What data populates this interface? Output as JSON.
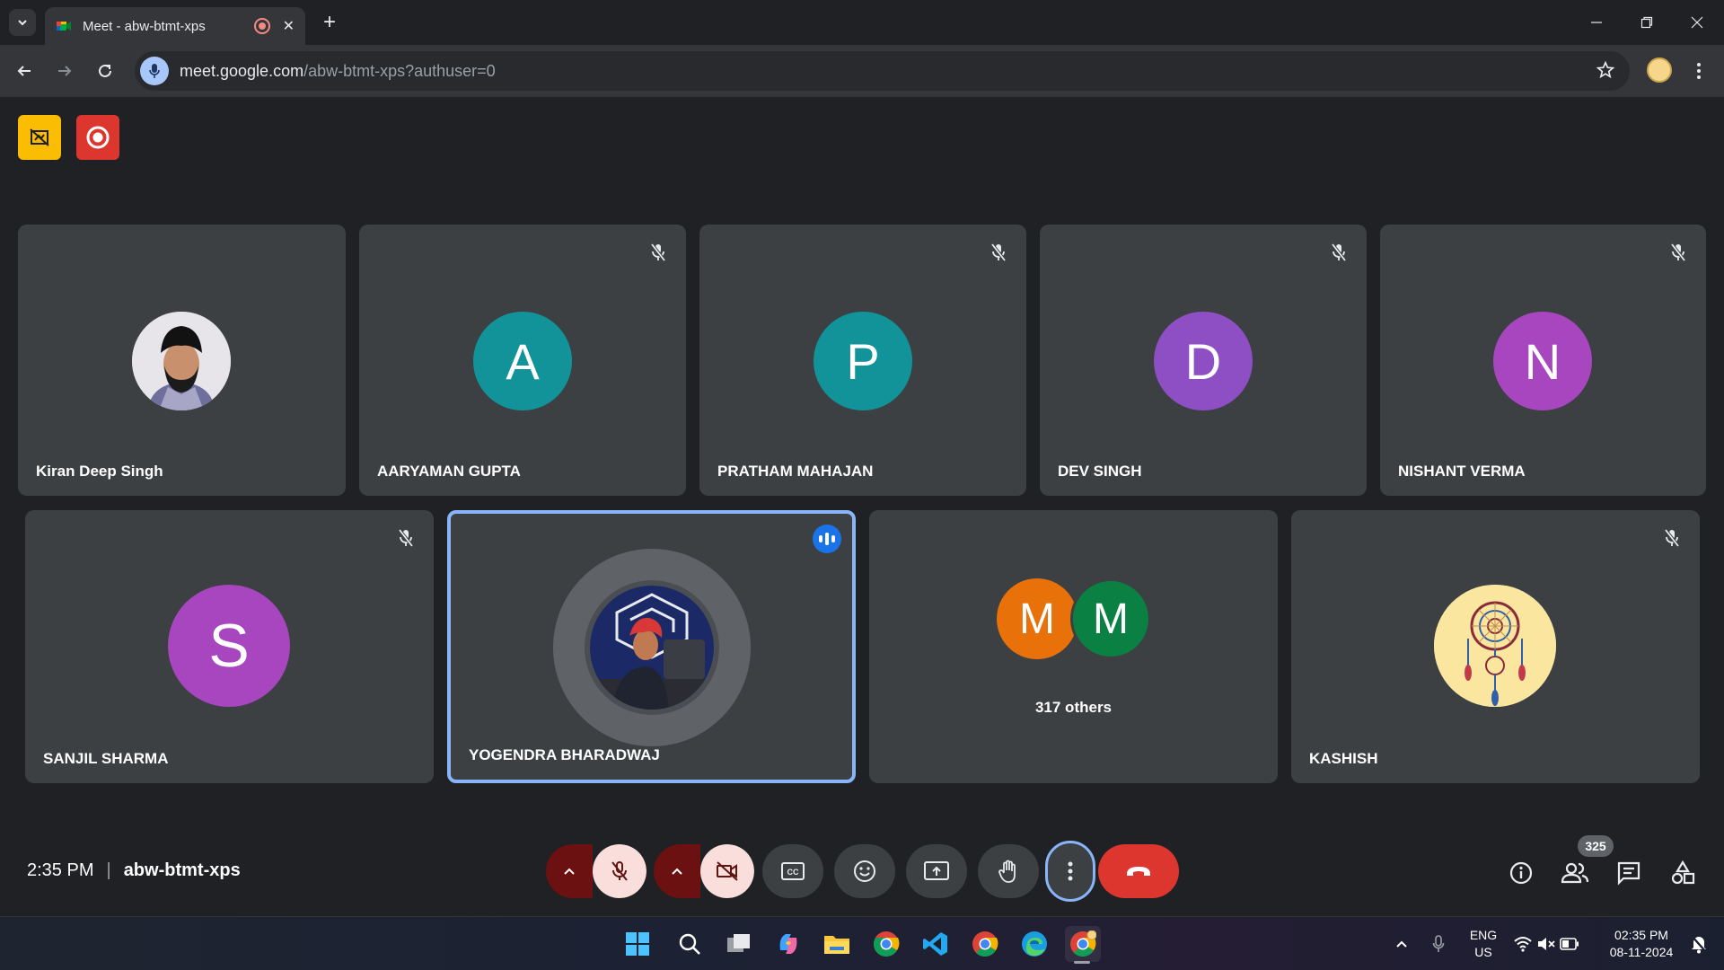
{
  "browser": {
    "tab_title": "Meet - abw-btmt-xps",
    "url_host": "meet.google.com",
    "url_path": "/abw-btmt-xps?authuser=0"
  },
  "meet": {
    "participants": [
      {
        "name": "Kiran Deep Singh",
        "avatar": "photo",
        "muted": false
      },
      {
        "name": "AARYAMAN GUPTA",
        "initial": "A",
        "color": "#12939a",
        "muted": true
      },
      {
        "name": "PRATHAM MAHAJAN",
        "initial": "P",
        "color": "#12939a",
        "muted": true
      },
      {
        "name": "DEV SINGH",
        "initial": "D",
        "color": "#8e4fc4",
        "muted": true
      },
      {
        "name": "NISHANT VERMA",
        "initial": "N",
        "color": "#a746bf",
        "muted": true
      },
      {
        "name": "SANJIL SHARMA",
        "initial": "S",
        "color": "#a746bf",
        "muted": true
      },
      {
        "name": "YOGENDRA BHARADWAJ",
        "avatar": "photo",
        "speaking": true
      },
      {
        "name": "KASHISH",
        "avatar": "dreamcatcher",
        "muted": true
      }
    ],
    "others": {
      "initials": [
        "M",
        "M"
      ],
      "colors": [
        "#e8710a",
        "#0b8043"
      ],
      "label": "317 others"
    },
    "time": "2:35 PM",
    "meeting_code": "abw-btmt-xps",
    "people_count": "325",
    "accent": "#8ab4f8",
    "end_call_color": "#dc362e"
  },
  "taskbar": {
    "lang": "ENG",
    "region": "US",
    "time": "02:35 PM",
    "date": "08-11-2024"
  }
}
